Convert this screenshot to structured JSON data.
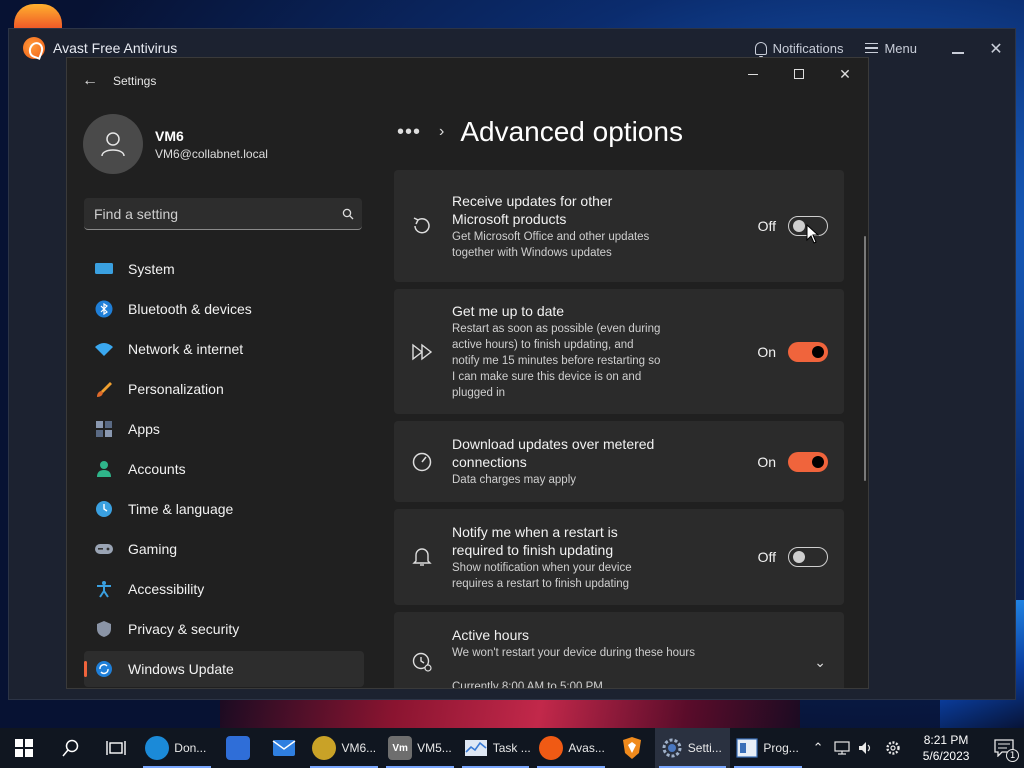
{
  "avast": {
    "title": "Avast Free Antivirus",
    "notifications_label": "Notifications",
    "menu_label": "Menu"
  },
  "settings": {
    "window_title": "Settings",
    "profile": {
      "name": "VM6",
      "email": "VM6@collabnet.local"
    },
    "search": {
      "placeholder": "Find a setting"
    },
    "nav": [
      {
        "label": "System",
        "icon": "system-icon"
      },
      {
        "label": "Bluetooth & devices",
        "icon": "bluetooth-icon"
      },
      {
        "label": "Network & internet",
        "icon": "network-icon"
      },
      {
        "label": "Personalization",
        "icon": "personalization-icon"
      },
      {
        "label": "Apps",
        "icon": "apps-icon"
      },
      {
        "label": "Accounts",
        "icon": "accounts-icon"
      },
      {
        "label": "Time & language",
        "icon": "time-language-icon"
      },
      {
        "label": "Gaming",
        "icon": "gaming-icon"
      },
      {
        "label": "Accessibility",
        "icon": "accessibility-icon"
      },
      {
        "label": "Privacy & security",
        "icon": "privacy-icon"
      },
      {
        "label": "Windows Update",
        "icon": "windows-update-icon",
        "active": true
      }
    ],
    "breadcrumb_dots": "•••",
    "page_title": "Advanced options",
    "options": [
      {
        "title": "Receive updates for other Microsoft products",
        "desc": "Get Microsoft Office and other updates together with Windows updates",
        "state": "Off",
        "on": false,
        "icon": "refresh-icon"
      },
      {
        "title": "Get me up to date",
        "desc": "Restart as soon as possible (even during active hours) to finish updating, and notify me 15 minutes before restarting so I can make sure this device is on and plugged in",
        "state": "On",
        "on": true,
        "icon": "fast-forward-icon"
      },
      {
        "title": "Download updates over metered connections",
        "desc": "Data charges may apply",
        "state": "On",
        "on": true,
        "icon": "speedometer-icon"
      },
      {
        "title": "Notify me when a restart is required to finish updating",
        "desc": "Show notification when your device requires a restart to finish updating",
        "state": "Off",
        "on": false,
        "icon": "bell-icon"
      }
    ],
    "active_hours": {
      "title": "Active hours",
      "desc": "We won't restart your device during these hours",
      "current": "Currently 8:00 AM to 5:00 PM"
    }
  },
  "taskbar": {
    "apps": [
      {
        "label": "Don...",
        "icon": "edge-icon",
        "color": "#1b8ad8"
      },
      {
        "label": "",
        "icon": "store-icon",
        "color": "#2f6ed8"
      },
      {
        "label": "",
        "icon": "mail-icon",
        "color": "#2f7fe0"
      },
      {
        "label": "VM6...",
        "icon": "vm-bee-icon",
        "color": "#c9a227"
      },
      {
        "label": "VM5...",
        "icon": "vmware-icon",
        "color": "#6e6e6e",
        "text": "Vm"
      },
      {
        "label": "Task ...",
        "icon": "task-manager-icon",
        "color": "#3a7bd5"
      },
      {
        "label": "Avas...",
        "icon": "avast-icon",
        "color": "#f05a14"
      },
      {
        "label": "",
        "icon": "brave-icon",
        "color": "#f08a1c"
      },
      {
        "label": "Setti...",
        "icon": "settings-gear-icon",
        "color": "#5b6b80"
      },
      {
        "label": "Prog...",
        "icon": "programs-icon",
        "color": "#3a6fb8"
      }
    ],
    "clock_time": "8:21 PM",
    "clock_date": "5/6/2023",
    "notification_count": "1"
  }
}
